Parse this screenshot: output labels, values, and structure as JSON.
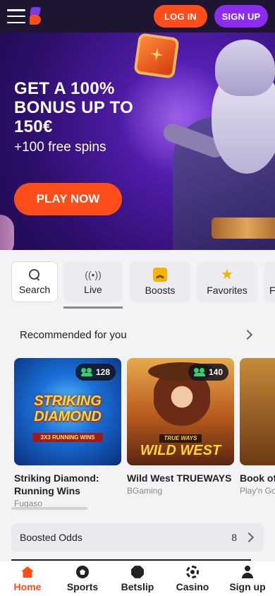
{
  "header": {
    "login_label": "LOG IN",
    "signup_label": "SIGN UP"
  },
  "hero": {
    "title": "GET A 100% BONUS UP TO 150€",
    "subtitle": "+100 free spins",
    "cta_label": "PLAY NOW"
  },
  "categories": [
    {
      "label": "Search",
      "icon": "search-icon"
    },
    {
      "label": "Live",
      "icon": "live-icon"
    },
    {
      "label": "Boosts",
      "icon": "boosts-icon"
    },
    {
      "label": "Favorites",
      "icon": "star-icon"
    },
    {
      "label": "F",
      "icon": ""
    }
  ],
  "recommended": {
    "title": "Recommended for you",
    "games": [
      {
        "name": "Striking Diamond: Running Wins",
        "provider": "Fugaso",
        "players": "128",
        "art_title": "STRIKING DIAMOND",
        "art_sub": "3X3 RUNNING WINS"
      },
      {
        "name": "Wild West TRUEWAYS",
        "provider": "BGaming",
        "players": "140",
        "art_title": "WILD WEST",
        "art_sub": "TRUE WAYS"
      },
      {
        "name": "Book of",
        "provider": "Play'n Go"
      }
    ]
  },
  "boosted": {
    "label": "Boosted Odds",
    "count": "8"
  },
  "bottom_nav": [
    {
      "label": "Home",
      "active": true
    },
    {
      "label": "Sports"
    },
    {
      "label": "Betslip"
    },
    {
      "label": "Casino"
    },
    {
      "label": "Sign up"
    }
  ],
  "colors": {
    "accent": "#ff4d1a",
    "brand_purple": "#8b2cf0",
    "topbar": "#1e1530"
  }
}
